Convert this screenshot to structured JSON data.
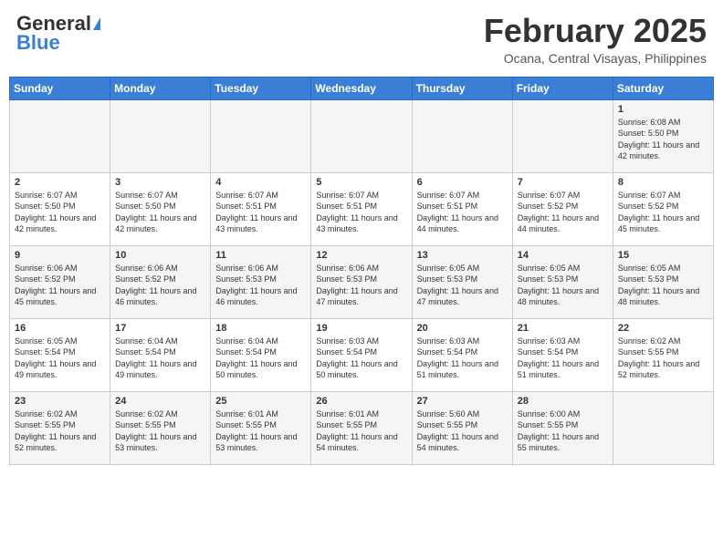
{
  "header": {
    "logo_general": "General",
    "logo_blue": "Blue",
    "month": "February 2025",
    "location": "Ocana, Central Visayas, Philippines"
  },
  "weekdays": [
    "Sunday",
    "Monday",
    "Tuesday",
    "Wednesday",
    "Thursday",
    "Friday",
    "Saturday"
  ],
  "weeks": [
    [
      {
        "day": "",
        "sunrise": "",
        "sunset": "",
        "daylight": ""
      },
      {
        "day": "",
        "sunrise": "",
        "sunset": "",
        "daylight": ""
      },
      {
        "day": "",
        "sunrise": "",
        "sunset": "",
        "daylight": ""
      },
      {
        "day": "",
        "sunrise": "",
        "sunset": "",
        "daylight": ""
      },
      {
        "day": "",
        "sunrise": "",
        "sunset": "",
        "daylight": ""
      },
      {
        "day": "",
        "sunrise": "",
        "sunset": "",
        "daylight": ""
      },
      {
        "day": "1",
        "sunrise": "Sunrise: 6:08 AM",
        "sunset": "Sunset: 5:50 PM",
        "daylight": "Daylight: 11 hours and 42 minutes."
      }
    ],
    [
      {
        "day": "2",
        "sunrise": "Sunrise: 6:07 AM",
        "sunset": "Sunset: 5:50 PM",
        "daylight": "Daylight: 11 hours and 42 minutes."
      },
      {
        "day": "3",
        "sunrise": "Sunrise: 6:07 AM",
        "sunset": "Sunset: 5:50 PM",
        "daylight": "Daylight: 11 hours and 42 minutes."
      },
      {
        "day": "4",
        "sunrise": "Sunrise: 6:07 AM",
        "sunset": "Sunset: 5:51 PM",
        "daylight": "Daylight: 11 hours and 43 minutes."
      },
      {
        "day": "5",
        "sunrise": "Sunrise: 6:07 AM",
        "sunset": "Sunset: 5:51 PM",
        "daylight": "Daylight: 11 hours and 43 minutes."
      },
      {
        "day": "6",
        "sunrise": "Sunrise: 6:07 AM",
        "sunset": "Sunset: 5:51 PM",
        "daylight": "Daylight: 11 hours and 44 minutes."
      },
      {
        "day": "7",
        "sunrise": "Sunrise: 6:07 AM",
        "sunset": "Sunset: 5:52 PM",
        "daylight": "Daylight: 11 hours and 44 minutes."
      },
      {
        "day": "8",
        "sunrise": "Sunrise: 6:07 AM",
        "sunset": "Sunset: 5:52 PM",
        "daylight": "Daylight: 11 hours and 45 minutes."
      }
    ],
    [
      {
        "day": "9",
        "sunrise": "Sunrise: 6:06 AM",
        "sunset": "Sunset: 5:52 PM",
        "daylight": "Daylight: 11 hours and 45 minutes."
      },
      {
        "day": "10",
        "sunrise": "Sunrise: 6:06 AM",
        "sunset": "Sunset: 5:52 PM",
        "daylight": "Daylight: 11 hours and 46 minutes."
      },
      {
        "day": "11",
        "sunrise": "Sunrise: 6:06 AM",
        "sunset": "Sunset: 5:53 PM",
        "daylight": "Daylight: 11 hours and 46 minutes."
      },
      {
        "day": "12",
        "sunrise": "Sunrise: 6:06 AM",
        "sunset": "Sunset: 5:53 PM",
        "daylight": "Daylight: 11 hours and 47 minutes."
      },
      {
        "day": "13",
        "sunrise": "Sunrise: 6:05 AM",
        "sunset": "Sunset: 5:53 PM",
        "daylight": "Daylight: 11 hours and 47 minutes."
      },
      {
        "day": "14",
        "sunrise": "Sunrise: 6:05 AM",
        "sunset": "Sunset: 5:53 PM",
        "daylight": "Daylight: 11 hours and 48 minutes."
      },
      {
        "day": "15",
        "sunrise": "Sunrise: 6:05 AM",
        "sunset": "Sunset: 5:53 PM",
        "daylight": "Daylight: 11 hours and 48 minutes."
      }
    ],
    [
      {
        "day": "16",
        "sunrise": "Sunrise: 6:05 AM",
        "sunset": "Sunset: 5:54 PM",
        "daylight": "Daylight: 11 hours and 49 minutes."
      },
      {
        "day": "17",
        "sunrise": "Sunrise: 6:04 AM",
        "sunset": "Sunset: 5:54 PM",
        "daylight": "Daylight: 11 hours and 49 minutes."
      },
      {
        "day": "18",
        "sunrise": "Sunrise: 6:04 AM",
        "sunset": "Sunset: 5:54 PM",
        "daylight": "Daylight: 11 hours and 50 minutes."
      },
      {
        "day": "19",
        "sunrise": "Sunrise: 6:03 AM",
        "sunset": "Sunset: 5:54 PM",
        "daylight": "Daylight: 11 hours and 50 minutes."
      },
      {
        "day": "20",
        "sunrise": "Sunrise: 6:03 AM",
        "sunset": "Sunset: 5:54 PM",
        "daylight": "Daylight: 11 hours and 51 minutes."
      },
      {
        "day": "21",
        "sunrise": "Sunrise: 6:03 AM",
        "sunset": "Sunset: 5:54 PM",
        "daylight": "Daylight: 11 hours and 51 minutes."
      },
      {
        "day": "22",
        "sunrise": "Sunrise: 6:02 AM",
        "sunset": "Sunset: 5:55 PM",
        "daylight": "Daylight: 11 hours and 52 minutes."
      }
    ],
    [
      {
        "day": "23",
        "sunrise": "Sunrise: 6:02 AM",
        "sunset": "Sunset: 5:55 PM",
        "daylight": "Daylight: 11 hours and 52 minutes."
      },
      {
        "day": "24",
        "sunrise": "Sunrise: 6:02 AM",
        "sunset": "Sunset: 5:55 PM",
        "daylight": "Daylight: 11 hours and 53 minutes."
      },
      {
        "day": "25",
        "sunrise": "Sunrise: 6:01 AM",
        "sunset": "Sunset: 5:55 PM",
        "daylight": "Daylight: 11 hours and 53 minutes."
      },
      {
        "day": "26",
        "sunrise": "Sunrise: 6:01 AM",
        "sunset": "Sunset: 5:55 PM",
        "daylight": "Daylight: 11 hours and 54 minutes."
      },
      {
        "day": "27",
        "sunrise": "Sunrise: 5:60 AM",
        "sunset": "Sunset: 5:55 PM",
        "daylight": "Daylight: 11 hours and 54 minutes."
      },
      {
        "day": "28",
        "sunrise": "Sunrise: 6:00 AM",
        "sunset": "Sunset: 5:55 PM",
        "daylight": "Daylight: 11 hours and 55 minutes."
      },
      {
        "day": "",
        "sunrise": "",
        "sunset": "",
        "daylight": ""
      }
    ]
  ]
}
